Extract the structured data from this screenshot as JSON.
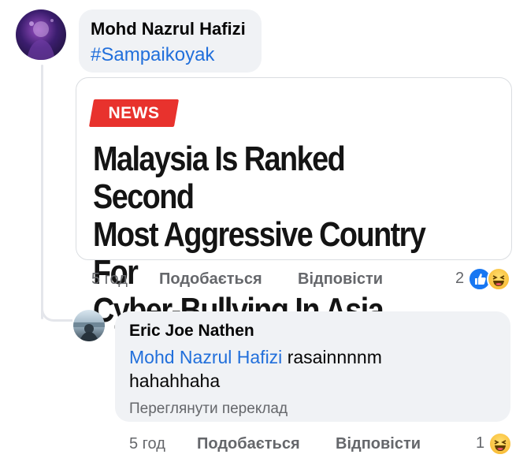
{
  "comment": {
    "author": "Mohd Nazrul Hafizi",
    "hashtag": "#Sampaikoyak",
    "card": {
      "tag": "NEWS",
      "headline_lines": [
        "Malaysia Is Ranked Second",
        "Most Aggressive Country For",
        "Cyber-Bullying In Asia"
      ]
    },
    "time": "5 год",
    "like_label": "Подобається",
    "reply_label": "Відповісти",
    "reaction_count": "2",
    "reactions": [
      "like-icon",
      "haha-icon"
    ]
  },
  "reply": {
    "author": "Eric Joe Nathen",
    "mention": "Mohd Nazrul Hafizi",
    "text_after_mention": "rasainnnnm",
    "text_line2": "hahahhaha",
    "translate_label": "Переглянути переклад",
    "time": "5 год",
    "like_label": "Подобається",
    "reply_label": "Відповісти",
    "reaction_count": "1",
    "reactions": [
      "haha-icon"
    ]
  },
  "colors": {
    "link_blue": "#216fdb",
    "bubble_bg": "#f0f2f5",
    "meta_gray": "#65676b",
    "news_red": "#e8322d",
    "like_blue": "#1877f2"
  }
}
